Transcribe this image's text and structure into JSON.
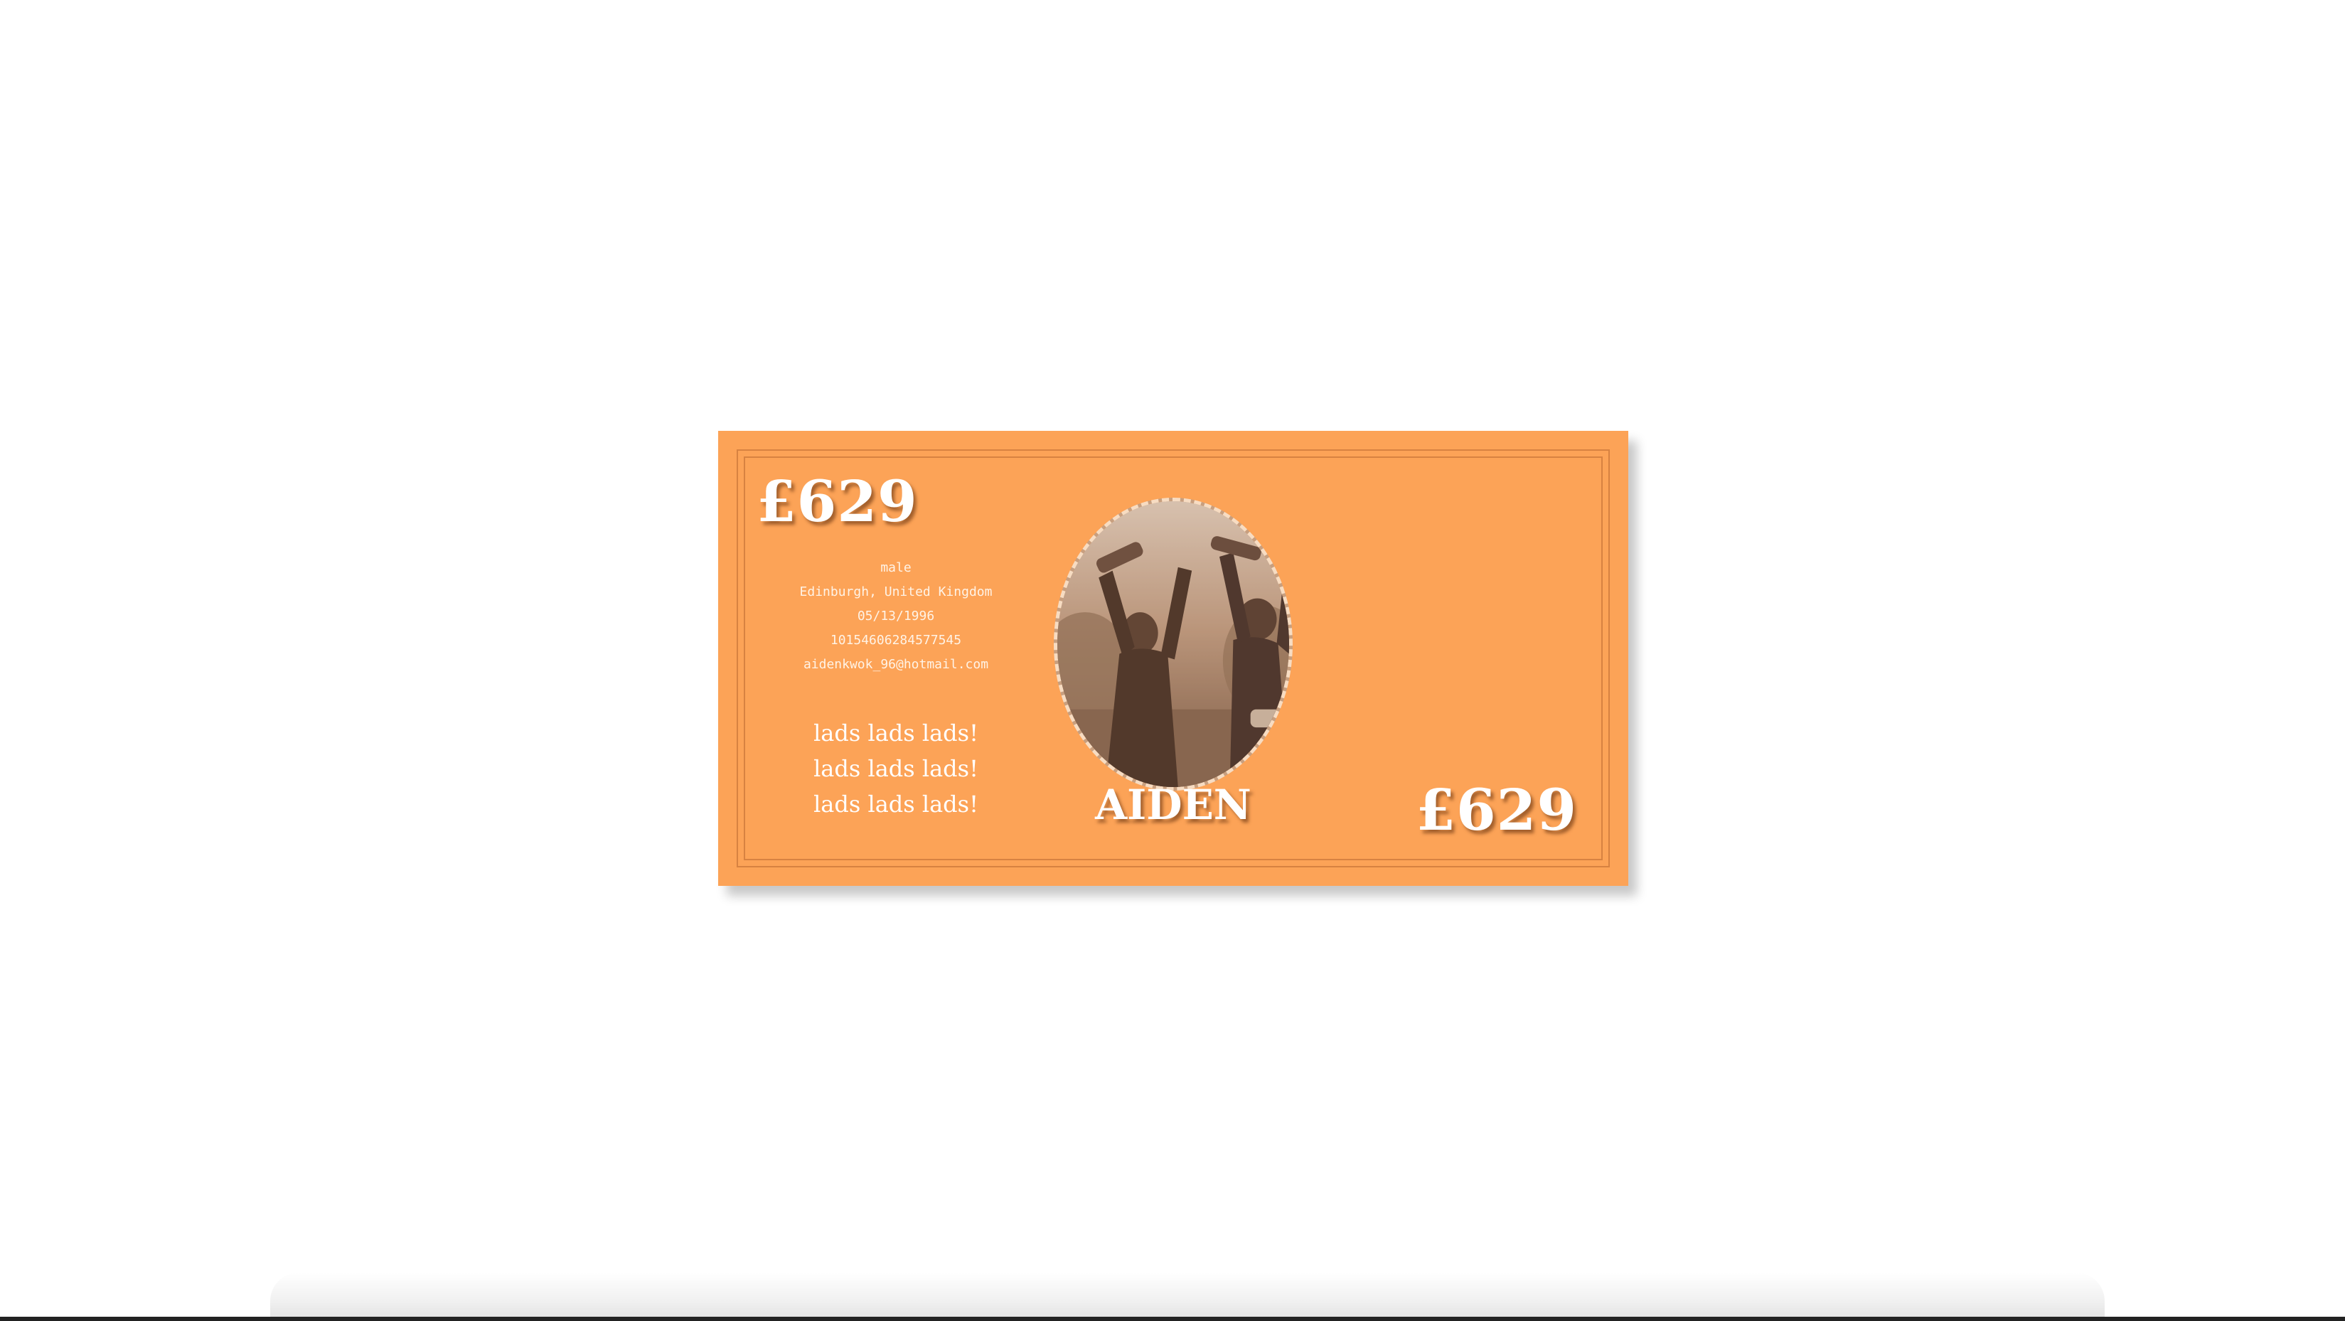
{
  "banknote": {
    "denomination_top": "£629",
    "denomination_bottom": "£629",
    "name": "AIDEN",
    "details": {
      "gender": "male",
      "location": "Edinburgh, United Kingdom",
      "birthdate": "05/13/1996",
      "id_number": "10154606284577545",
      "email": "aidenkwok_96@hotmail.com"
    },
    "motto_lines": [
      "lads lads lads!",
      "lads lads lads!",
      "lads lads lads!"
    ],
    "colors": {
      "note_background": "#fca357",
      "text": "#ffffff",
      "portrait_tint": "#7a5a45"
    }
  }
}
